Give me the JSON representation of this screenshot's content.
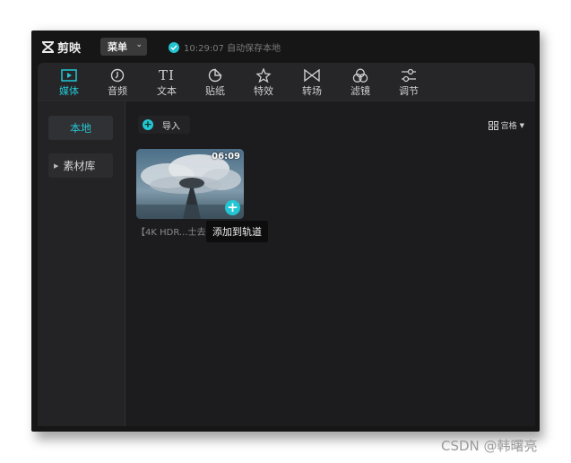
{
  "app": {
    "name": "剪映",
    "menu_label": "菜单",
    "save_status": "10:29:07 自动保存本地"
  },
  "toolbar": {
    "items": [
      {
        "label": "媒体",
        "icon": "media-icon",
        "active": true
      },
      {
        "label": "音频",
        "icon": "audio-icon",
        "active": false
      },
      {
        "label": "文本",
        "icon": "text-icon",
        "icon_text": "TI",
        "active": false
      },
      {
        "label": "贴纸",
        "icon": "sticker-icon",
        "active": false
      },
      {
        "label": "特效",
        "icon": "effects-icon",
        "active": false
      },
      {
        "label": "转场",
        "icon": "transition-icon",
        "active": false
      },
      {
        "label": "滤镜",
        "icon": "filter-icon",
        "active": false
      },
      {
        "label": "调节",
        "icon": "adjust-icon",
        "active": false
      }
    ]
  },
  "sidebar": {
    "items": [
      {
        "label": "本地",
        "active": true
      },
      {
        "label": "素材库",
        "active": false
      }
    ]
  },
  "content": {
    "import_label": "导入",
    "sort_label": "宫格",
    "media": [
      {
        "duration": "06:09",
        "title": "【4K HDR...士去"
      }
    ],
    "tooltip": "添加到轨道"
  },
  "watermark": "CSDN @韩曙亮",
  "colors": {
    "accent": "#22c7d3",
    "background": "#1c1c1e",
    "toolbar": "#262629"
  }
}
